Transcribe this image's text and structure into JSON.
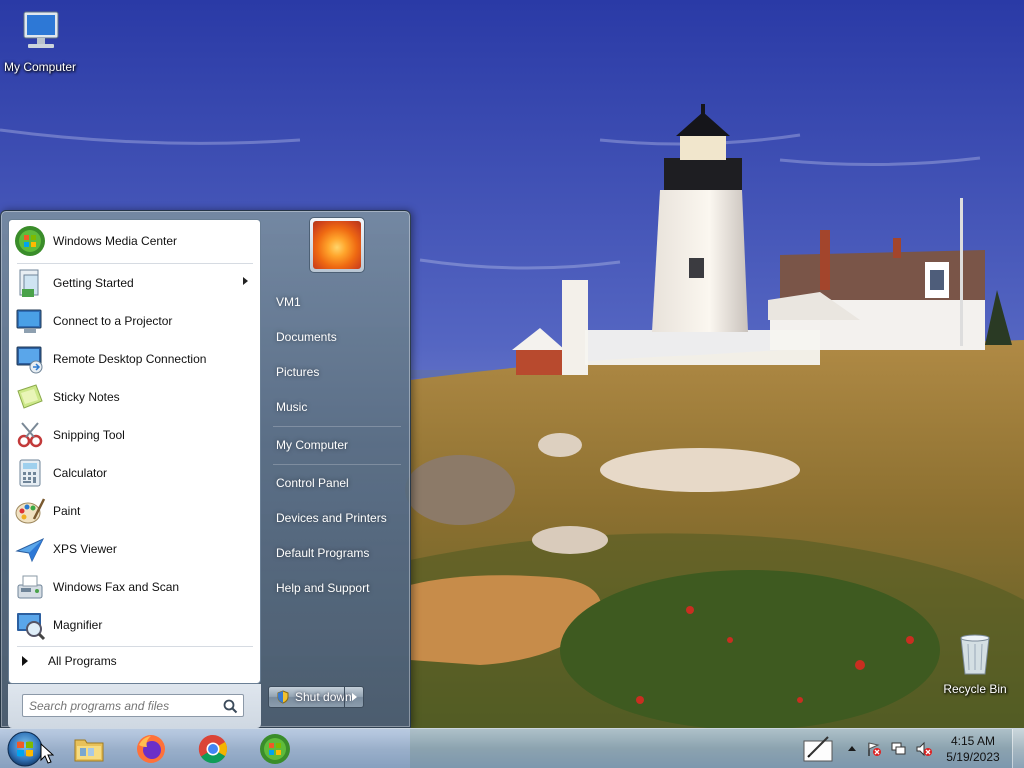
{
  "desktop": {
    "icons": [
      {
        "label": "My Computer",
        "icon": "computer-icon"
      },
      {
        "label": "Recycle Bin",
        "icon": "recycle-bin-icon"
      }
    ]
  },
  "start_menu": {
    "programs": [
      {
        "label": "Windows Media Center",
        "icon": "windows-media-center-icon"
      },
      {
        "label": "Getting Started",
        "icon": "getting-started-icon",
        "has_submenu": true
      },
      {
        "label": "Connect to a Projector",
        "icon": "projector-icon"
      },
      {
        "label": "Remote Desktop Connection",
        "icon": "remote-desktop-icon"
      },
      {
        "label": "Sticky Notes",
        "icon": "sticky-notes-icon"
      },
      {
        "label": "Snipping Tool",
        "icon": "snipping-tool-icon"
      },
      {
        "label": "Calculator",
        "icon": "calculator-icon"
      },
      {
        "label": "Paint",
        "icon": "paint-icon"
      },
      {
        "label": "XPS Viewer",
        "icon": "xps-viewer-icon"
      },
      {
        "label": "Windows Fax and Scan",
        "icon": "fax-scan-icon"
      },
      {
        "label": "Magnifier",
        "icon": "magnifier-icon"
      }
    ],
    "all_programs_label": "All Programs",
    "search_placeholder": "Search programs and files",
    "places": [
      "VM1",
      "Documents",
      "Pictures",
      "Music",
      "My Computer",
      "Control Panel",
      "Devices and Printers",
      "Default Programs",
      "Help and Support"
    ],
    "shutdown_label": "Shut down"
  },
  "taskbar": {
    "pinned": [
      {
        "name": "file-explorer",
        "icon": "folder-icon"
      },
      {
        "name": "firefox",
        "icon": "firefox-icon"
      },
      {
        "name": "chrome",
        "icon": "chrome-icon"
      },
      {
        "name": "windows-media-center",
        "icon": "windows-media-center-icon"
      }
    ],
    "clock": {
      "time": "4:15 AM",
      "date": "5/19/2023"
    }
  },
  "colors": {
    "sky_top": "#2e3fa8",
    "sky_bottom": "#9aa6e0",
    "grass": "#9a7a3a",
    "menu_glass": "#6e8296"
  }
}
